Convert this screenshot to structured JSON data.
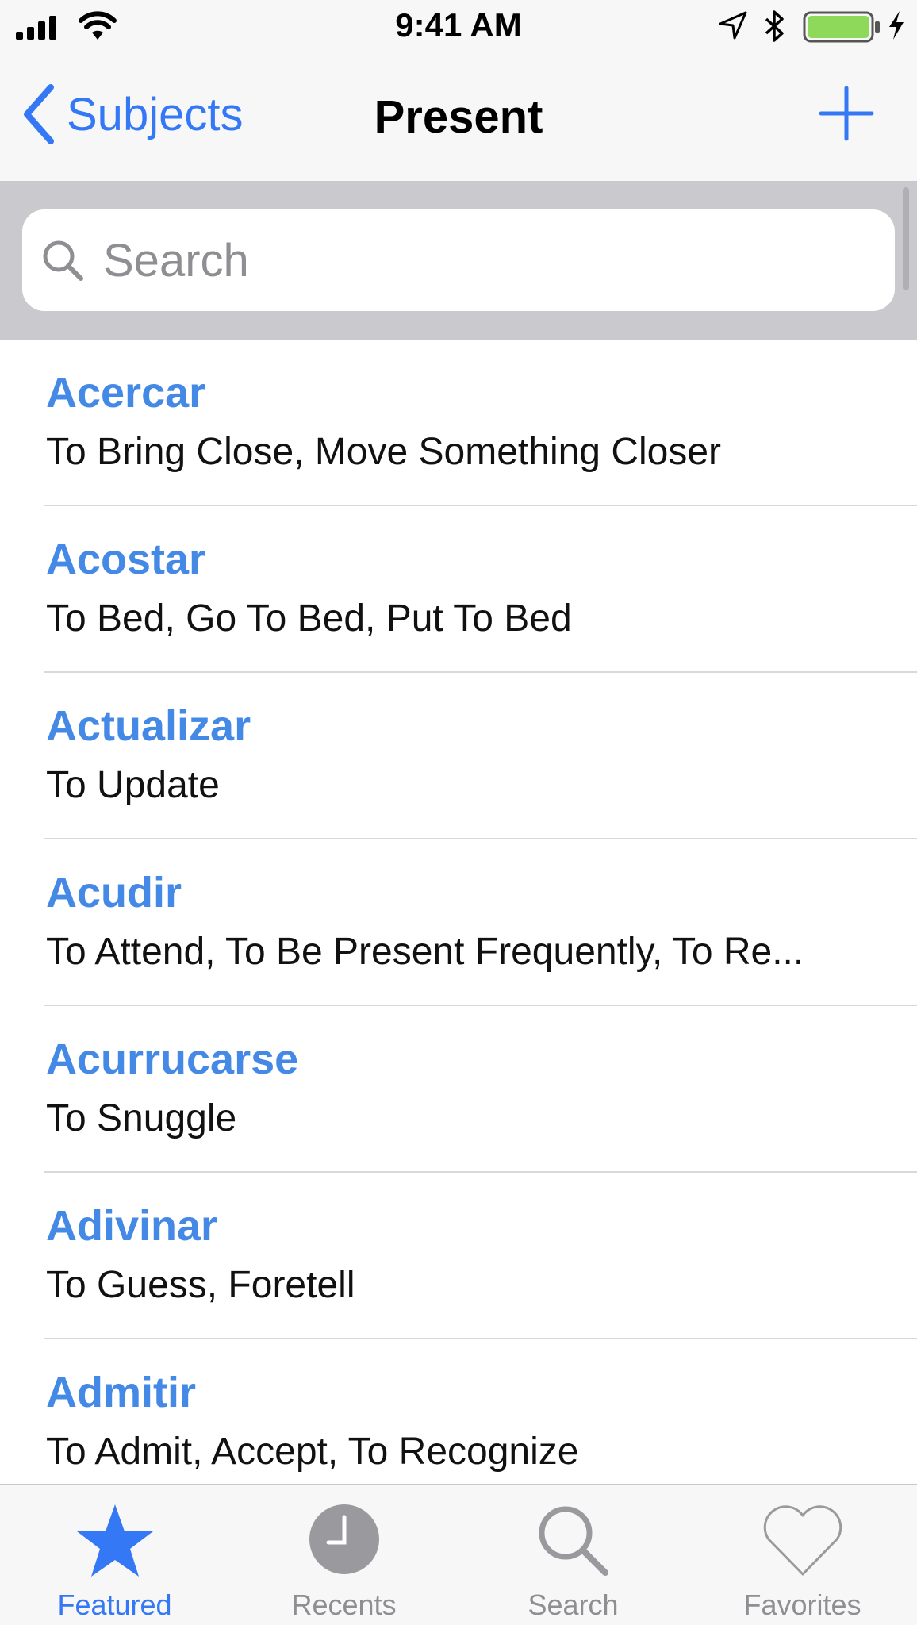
{
  "status_bar": {
    "time": "9:41 AM",
    "icons": [
      "signal-icon",
      "wifi-icon",
      "location-arrow-icon",
      "bluetooth-icon",
      "battery-icon",
      "charging-bolt-icon"
    ]
  },
  "nav": {
    "back_label": "Subjects",
    "title": "Present"
  },
  "search": {
    "placeholder": "Search",
    "value": ""
  },
  "list": {
    "items": [
      {
        "title": "Acercar",
        "subtitle": "To Bring Close, Move Something Closer"
      },
      {
        "title": "Acostar",
        "subtitle": "To Bed, Go To Bed, Put To Bed"
      },
      {
        "title": "Actualizar",
        "subtitle": "To Update"
      },
      {
        "title": "Acudir",
        "subtitle": "To Attend, To Be Present Frequently, To Re..."
      },
      {
        "title": "Acurrucarse",
        "subtitle": "To Snuggle"
      },
      {
        "title": "Adivinar",
        "subtitle": "To Guess, Foretell"
      },
      {
        "title": "Admitir",
        "subtitle": "To Admit, Accept, To Recognize"
      }
    ]
  },
  "tabs": [
    {
      "label": "Featured",
      "icon": "star-icon",
      "active": true
    },
    {
      "label": "Recents",
      "icon": "clock-icon",
      "active": false
    },
    {
      "label": "Search",
      "icon": "search-icon",
      "active": false
    },
    {
      "label": "Favorites",
      "icon": "heart-icon",
      "active": false
    }
  ],
  "colors": {
    "accent": "#3478f6",
    "item_title": "#4589e6",
    "bar_background": "#f7f7f7",
    "search_background": "#c9c9ce",
    "inactive_tab": "#8e8e93",
    "battery_fill": "#8fd95a"
  }
}
